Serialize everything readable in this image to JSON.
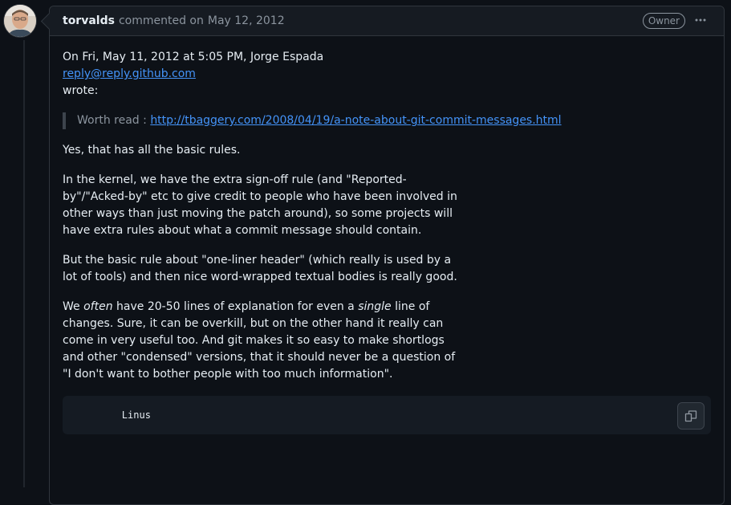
{
  "comment": {
    "author": "torvalds",
    "action": "commented on",
    "date": "May 12, 2012",
    "badge": "Owner",
    "menu_icon": "kebab-horizontal-icon"
  },
  "body": {
    "intro_line1": "On Fri, May 11, 2012 at 5:05 PM, Jorge Espada",
    "intro_email": "reply@reply.github.com",
    "intro_line3": "wrote:",
    "quote_prefix": "Worth read : ",
    "quote_link": "http://tbaggery.com/2008/04/19/a-note-about-git-commit-messages.html",
    "p1": "Yes, that has all the basic rules.",
    "p2": "In the kernel, we have the extra sign-off rule (and \"Reported-by\"/\"Acked-by\" etc to give credit to people who have been involved in other ways than just moving the patch around), so some projects will have extra rules about what a commit message should contain.",
    "p3": "But the basic rule about \"one-liner header\" (which really is used by a lot of tools) and then nice word-wrapped textual bodies is really good.",
    "p4_a": "We ",
    "p4_em1": "often",
    "p4_b": " have 20-50 lines of explanation for even a ",
    "p4_em2": "single",
    "p4_c": " line of changes. Sure, it can be overkill, but on the other hand it really can come in very useful too. And git makes it so easy to make shortlogs and other \"condensed\" versions, that it should never be a question of \"I don't want to bother people with too much information\".",
    "code": "        Linus",
    "copy_icon": "copy-icon"
  },
  "colors": {
    "background": "#0d1117",
    "header_bg": "#161b22",
    "border": "#30363d",
    "link": "#4493f8",
    "muted": "#8b949e"
  }
}
